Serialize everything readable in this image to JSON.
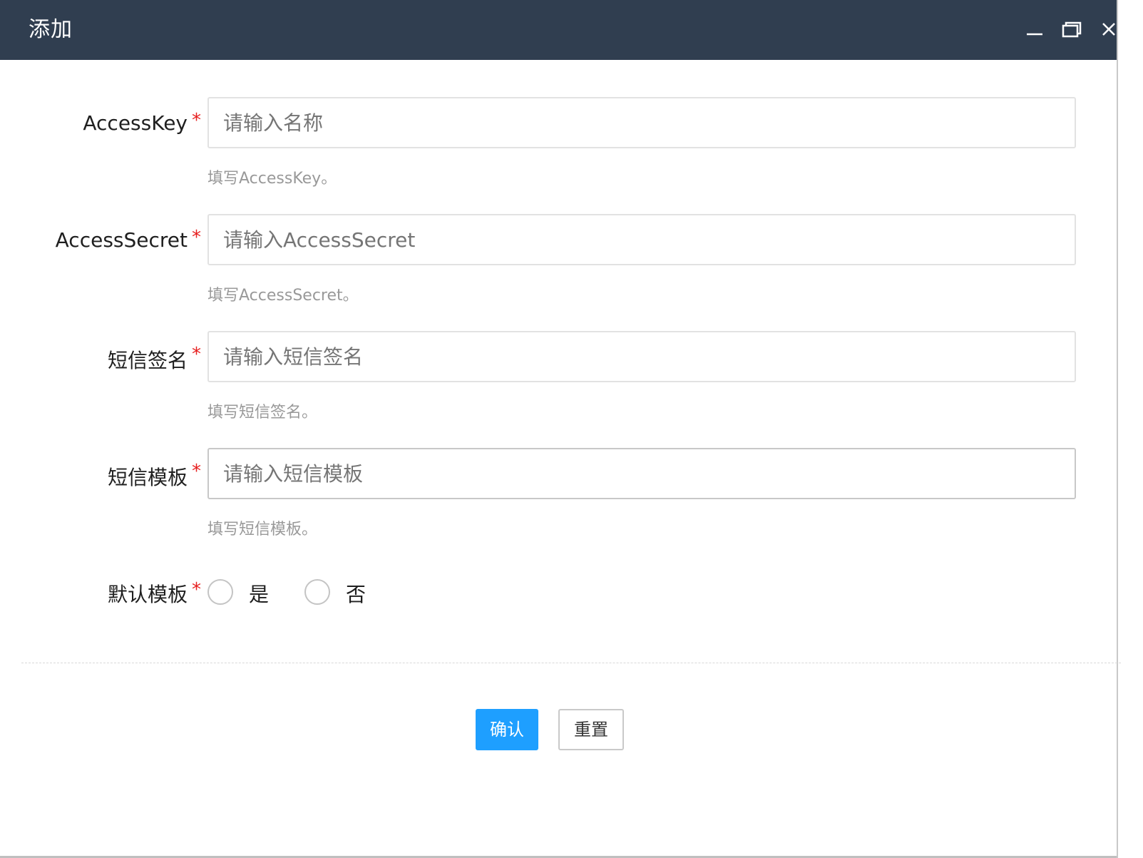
{
  "window": {
    "title": "添加",
    "titlebar_color": "#303e50",
    "controls": [
      "minimize-icon",
      "maximize-icon",
      "close-icon"
    ]
  },
  "form": {
    "fields": [
      {
        "label": "AccessKey",
        "required": "*",
        "placeholder": "请输入名称",
        "value": "",
        "help": "填写AccessKey。"
      },
      {
        "label": "AccessSecret",
        "required": "*",
        "placeholder": "请输入AccessSecret",
        "value": "",
        "help": "填写AccessSecret。"
      },
      {
        "label": "短信签名",
        "required": "*",
        "placeholder": "请输入短信签名",
        "value": "",
        "help": "填写短信签名。"
      },
      {
        "label": "短信模板",
        "required": "*",
        "placeholder": "请输入短信模板",
        "value": "",
        "help": "填写短信模板。"
      }
    ],
    "default_template": {
      "label": "默认模板",
      "required": "*",
      "options": [
        "是",
        "否"
      ],
      "selected": null
    }
  },
  "actions": {
    "confirm_label": "确认",
    "reset_label": "重置",
    "primary_color": "#1e9fff"
  }
}
